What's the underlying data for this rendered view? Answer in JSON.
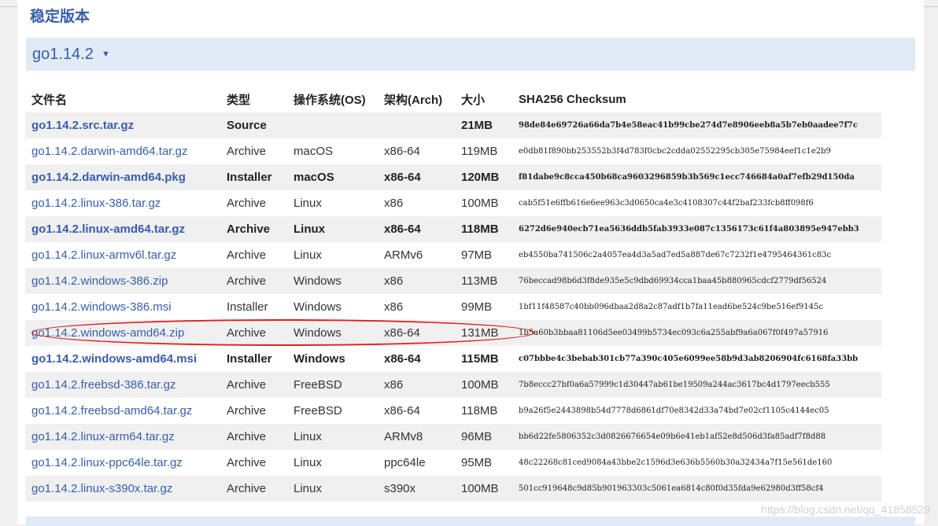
{
  "section_title": "稳定版本",
  "release": {
    "version": "go1.14.2",
    "caret": "▼"
  },
  "table": {
    "headers": [
      "文件名",
      "类型",
      "操作系统(OS)",
      "架构(Arch)",
      "大小",
      "SHA256 Checksum"
    ],
    "rows": [
      {
        "file": "go1.14.2.src.tar.gz",
        "kind": "Source",
        "os": "",
        "arch": "",
        "size": "21MB",
        "sha": "98de84e69726a66da7b4e58eac41b99cbe274d7e8906eeb8a5b7eb0aadee7f7c",
        "bold": true
      },
      {
        "file": "go1.14.2.darwin-amd64.tar.gz",
        "kind": "Archive",
        "os": "macOS",
        "arch": "x86-64",
        "size": "119MB",
        "sha": "e0db81f890bb253552b3f4d783f0cbc2cdda02552295cb305e75984eef1c1e2b9",
        "bold": false
      },
      {
        "file": "go1.14.2.darwin-amd64.pkg",
        "kind": "Installer",
        "os": "macOS",
        "arch": "x86-64",
        "size": "120MB",
        "sha": "f81dabe9c8cca450b68ca9603296859b3b569c1ecc746684a0af7efb29d150da",
        "bold": true
      },
      {
        "file": "go1.14.2.linux-386.tar.gz",
        "kind": "Archive",
        "os": "Linux",
        "arch": "x86",
        "size": "100MB",
        "sha": "cab5f51e6ffb616e6ee963c3d0650ca4e3c4108307c44f2baf233fcb8ff098f6",
        "bold": false
      },
      {
        "file": "go1.14.2.linux-amd64.tar.gz",
        "kind": "Archive",
        "os": "Linux",
        "arch": "x86-64",
        "size": "118MB",
        "sha": "6272d6e940ecb71ea5636ddb5fab3933e087c1356173c61f4a803895e947ebb3",
        "bold": true
      },
      {
        "file": "go1.14.2.linux-armv6l.tar.gz",
        "kind": "Archive",
        "os": "Linux",
        "arch": "ARMv6",
        "size": "97MB",
        "sha": "eb4550ba741506c2a4057ea4d3a5ad7ed5a887de67c7232f1e4795464361c83c",
        "bold": false
      },
      {
        "file": "go1.14.2.windows-386.zip",
        "kind": "Archive",
        "os": "Windows",
        "arch": "x86",
        "size": "113MB",
        "sha": "76beccad98b6d3f8de935e5c9dbd69934cca1baa45b880965cdcf2779df56524",
        "bold": false
      },
      {
        "file": "go1.14.2.windows-386.msi",
        "kind": "Installer",
        "os": "Windows",
        "arch": "x86",
        "size": "99MB",
        "sha": "1bf11f48587c40bb096dbaa2d8a2c87adf1b7fa11ead6be524c9be516ef9145c",
        "bold": false
      },
      {
        "file": "go1.14.2.windows-amd64.zip",
        "kind": "Archive",
        "os": "Windows",
        "arch": "x86-64",
        "size": "131MB",
        "sha": "1b5a60b3bbaa81106d5ee03499b5734ec093c6a255abf9a6a067f0f497a57916",
        "bold": false
      },
      {
        "file": "go1.14.2.windows-amd64.msi",
        "kind": "Installer",
        "os": "Windows",
        "arch": "x86-64",
        "size": "115MB",
        "sha": "c07bbbe4c3bebab301cb77a390c405e6099ee58b9d3ab8206904fc6168fa33bb",
        "bold": true
      },
      {
        "file": "go1.14.2.freebsd-386.tar.gz",
        "kind": "Archive",
        "os": "FreeBSD",
        "arch": "x86",
        "size": "100MB",
        "sha": "7b8eccc27bf0a6a57999c1d30447ab61be19509a244ac3617bc4d1797eecb555",
        "bold": false
      },
      {
        "file": "go1.14.2.freebsd-amd64.tar.gz",
        "kind": "Archive",
        "os": "FreeBSD",
        "arch": "x86-64",
        "size": "118MB",
        "sha": "b9a26f5e2443898b54d7778d6861df70e8342d33a74bd7e02cf1105c4144ec05",
        "bold": false
      },
      {
        "file": "go1.14.2.linux-arm64.tar.gz",
        "kind": "Archive",
        "os": "Linux",
        "arch": "ARMv8",
        "size": "96MB",
        "sha": "bb6d22fe5806352c3d0826676654e09b6e41eb1af52e8d506d3fa85adf7f8d88",
        "bold": false
      },
      {
        "file": "go1.14.2.linux-ppc64le.tar.gz",
        "kind": "Archive",
        "os": "Linux",
        "arch": "ppc64le",
        "size": "95MB",
        "sha": "48c22268c81ced9084a43bbe2c1596d3e636b5560b30a32434a7f15e561de160",
        "bold": false
      },
      {
        "file": "go1.14.2.linux-s390x.tar.gz",
        "kind": "Archive",
        "os": "Linux",
        "arch": "s390x",
        "size": "100MB",
        "sha": "501cc919648c9d85b901963303c5061ea6814c80f0d35fda9e62980d3ff58cf4",
        "bold": false
      }
    ]
  },
  "watermark": "https://blog.csdn.net/qq_41858529",
  "colors": {
    "link": "#375eab",
    "highlight_oval": "#e02020",
    "header_band": "#e0ebf5"
  }
}
